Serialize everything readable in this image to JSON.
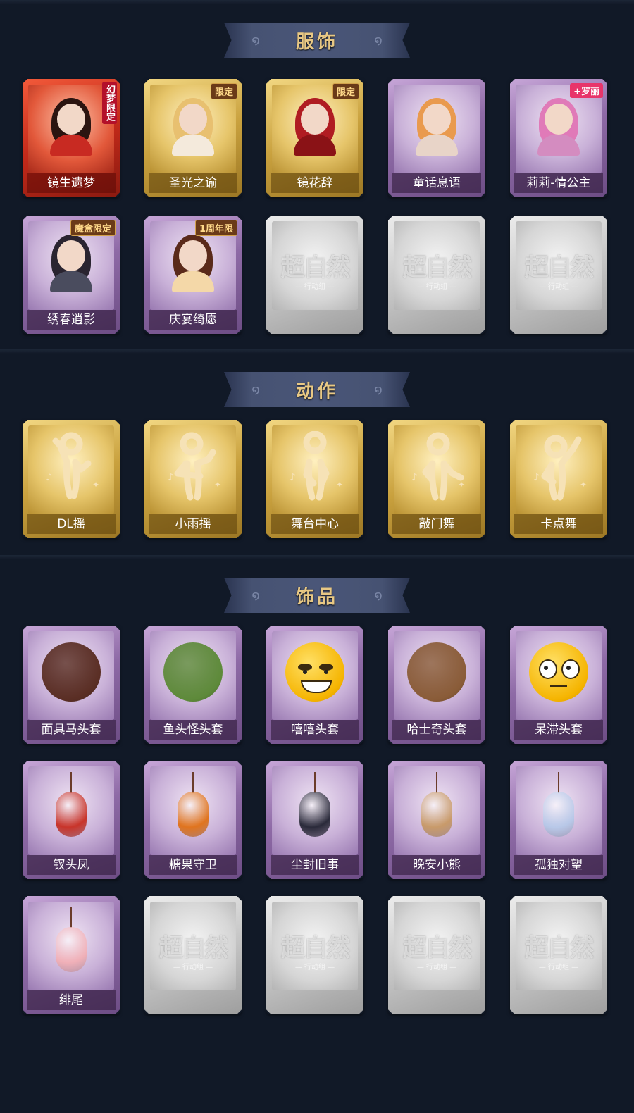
{
  "sections": [
    {
      "title": "服饰",
      "rows": [
        [
          {
            "name": "镜生遗梦",
            "style": "red",
            "badge": "幻梦限定",
            "badge_style": "vertical",
            "art": "avatar",
            "hair": "#2b1410",
            "body": "#c82a22"
          },
          {
            "name": "圣光之谕",
            "style": "gold",
            "badge": "限定",
            "badge_style": "gold",
            "art": "avatar",
            "hair": "#e8c070",
            "body": "#f4eadc"
          },
          {
            "name": "镜花辞",
            "style": "gold",
            "badge": "限定",
            "badge_style": "gold",
            "art": "avatar",
            "hair": "#b01c22",
            "body": "#8a1216"
          },
          {
            "name": "童话息语",
            "style": "purple",
            "badge": "",
            "art": "avatar",
            "hair": "#e99a4e",
            "body": "#e8d4c8"
          },
          {
            "name": "莉莉-情公主",
            "style": "purple",
            "badge": "+罗丽",
            "badge_style": "pink",
            "art": "avatar",
            "hair": "#e07ab8",
            "body": "#d48cc0"
          }
        ],
        [
          {
            "name": "绣春逍影",
            "style": "purple",
            "badge": "魔盒限定",
            "badge_style": "gold",
            "art": "avatar",
            "hair": "#2a2430",
            "body": "#4a4c5e"
          },
          {
            "name": "庆宴绮愿",
            "style": "purple",
            "badge": "1周年限",
            "badge_style": "gold",
            "art": "avatar",
            "hair": "#5a2a1a",
            "body": "#f4d8a8"
          },
          {
            "name": "",
            "style": "empty",
            "art": "watermark"
          },
          {
            "name": "",
            "style": "empty",
            "art": "watermark"
          },
          {
            "name": "",
            "style": "empty",
            "art": "watermark"
          }
        ]
      ]
    },
    {
      "title": "动作",
      "rows": [
        [
          {
            "name": "DL摇",
            "style": "gold",
            "art": "pose"
          },
          {
            "name": "小雨摇",
            "style": "gold",
            "art": "pose"
          },
          {
            "name": "舞台中心",
            "style": "gold",
            "art": "pose"
          },
          {
            "name": "敲门舞",
            "style": "gold",
            "art": "pose"
          },
          {
            "name": "卡点舞",
            "style": "gold",
            "art": "pose"
          }
        ]
      ]
    },
    {
      "title": "饰品",
      "rows": [
        [
          {
            "name": "面具马头套",
            "style": "purple",
            "art": "mask",
            "color": "#5a2e24"
          },
          {
            "name": "鱼头怪头套",
            "style": "purple",
            "art": "mask",
            "color": "#5e8a3a"
          },
          {
            "name": "嘻嘻头套",
            "style": "purple",
            "art": "emoji",
            "mood": "grin"
          },
          {
            "name": "哈士奇头套",
            "style": "purple",
            "art": "mask",
            "color": "#8a5c38"
          },
          {
            "name": "呆滞头套",
            "style": "purple",
            "art": "emoji",
            "mood": "stare"
          }
        ],
        [
          {
            "name": "钗头凤",
            "style": "purple",
            "art": "charm",
            "color": "#c8342a"
          },
          {
            "name": "糖果守卫",
            "style": "purple",
            "art": "charm",
            "color": "#e0741e"
          },
          {
            "name": "尘封旧事",
            "style": "purple",
            "art": "charm",
            "color": "#2a2a3a"
          },
          {
            "name": "晚安小熊",
            "style": "purple",
            "art": "charm",
            "color": "#c89a6a"
          },
          {
            "name": "孤独对望",
            "style": "purple",
            "art": "charm",
            "color": "#b8c8e8"
          }
        ],
        [
          {
            "name": "绯尾",
            "style": "purple",
            "art": "charm",
            "color": "#f0b0b8"
          },
          {
            "name": "",
            "style": "empty",
            "art": "watermark"
          },
          {
            "name": "",
            "style": "empty",
            "art": "watermark"
          },
          {
            "name": "",
            "style": "empty",
            "art": "watermark"
          },
          {
            "name": "",
            "style": "empty",
            "art": "watermark"
          }
        ]
      ]
    }
  ],
  "watermark": {
    "main": "超自然",
    "sub": "— 行动组 —"
  }
}
